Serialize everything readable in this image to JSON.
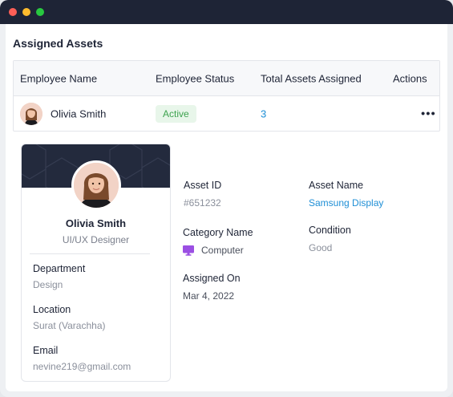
{
  "section": {
    "title": "Assigned Assets"
  },
  "table": {
    "headers": [
      "Employee Name",
      "Employee Status",
      "Total Assets Assigned",
      "Actions"
    ],
    "row": {
      "name": "Olivia Smith",
      "status": "Active",
      "total_assets": "3",
      "actions_icon": "more-horizontal-icon"
    }
  },
  "profile": {
    "name": "Olivia Smith",
    "role": "UI/UX Designer",
    "department_label": "Department",
    "department": "Design",
    "location_label": "Location",
    "location": "Surat (Varachha)",
    "email_label": "Email",
    "email": "nevine219@gmail.com"
  },
  "asset": {
    "id_label": "Asset ID",
    "id": "#651232",
    "name_label": "Asset Name",
    "name": "Samsung Display",
    "category_label": "Category Name",
    "category": "Computer",
    "category_icon": "monitor-icon",
    "condition_label": "Condition",
    "condition": "Good",
    "assigned_label": "Assigned On",
    "assigned": "Mar 4, 2022"
  },
  "colors": {
    "accent": "#1f8fd6",
    "status_bg": "#e8f6ea",
    "status_fg": "#3ea34f",
    "banner": "#232a3d",
    "category_icon": "#9b4fe3"
  }
}
